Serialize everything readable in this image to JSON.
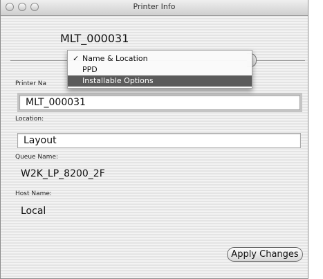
{
  "window": {
    "title": "Printer Info",
    "printer_name_header": "MLT_000031"
  },
  "popup_menu": {
    "items": [
      {
        "label": "Name & Location",
        "checked": true
      },
      {
        "label": "PPD",
        "checked": false
      },
      {
        "label": "Installable Options",
        "checked": false,
        "highlighted": true
      }
    ],
    "check_glyph": "✓"
  },
  "form": {
    "printer_name_label": "Printer Na",
    "printer_name_value": "MLT_000031",
    "location_label": "Location:",
    "location_value": "Layout",
    "queue_name_label": "Queue Name:",
    "queue_name_value": "W2K_LP_8200_2F",
    "host_name_label": "Host Name:",
    "host_name_value": "Local"
  },
  "buttons": {
    "apply_label": "Apply Changes"
  }
}
